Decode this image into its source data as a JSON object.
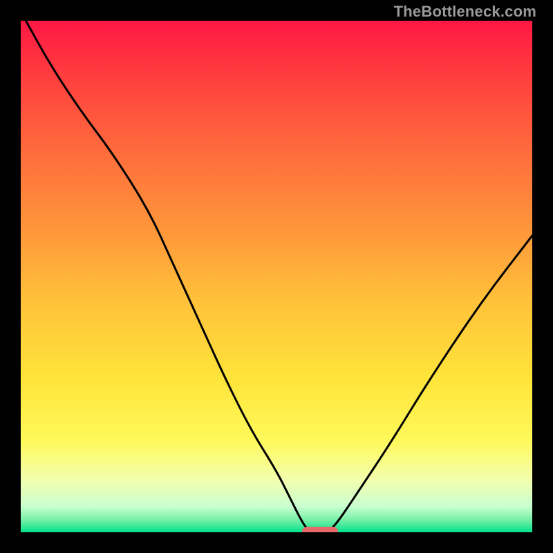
{
  "watermark": "TheBottleneck.com",
  "chart_data": {
    "type": "line",
    "title": "",
    "xlabel": "",
    "ylabel": "",
    "xlim": [
      0,
      100
    ],
    "ylim": [
      0,
      100
    ],
    "background_gradient_stops": [
      {
        "offset": 0.0,
        "color": "#ff1744"
      },
      {
        "offset": 0.1,
        "color": "#ff3b3f"
      },
      {
        "offset": 0.25,
        "color": "#ff6a3c"
      },
      {
        "offset": 0.4,
        "color": "#ff943a"
      },
      {
        "offset": 0.55,
        "color": "#ffc23a"
      },
      {
        "offset": 0.7,
        "color": "#ffe43a"
      },
      {
        "offset": 0.82,
        "color": "#fff95a"
      },
      {
        "offset": 0.9,
        "color": "#f2ffb0"
      },
      {
        "offset": 0.95,
        "color": "#c8ffd0"
      },
      {
        "offset": 0.975,
        "color": "#7af0a8"
      },
      {
        "offset": 1.0,
        "color": "#00e28a"
      }
    ],
    "series": [
      {
        "name": "bottleneck-curve",
        "x": [
          1,
          6,
          12,
          18,
          25,
          30,
          35,
          40,
          45,
          50,
          53,
          55,
          56.5,
          60,
          62,
          66,
          72,
          80,
          90,
          100
        ],
        "y": [
          100,
          91,
          82,
          74,
          63,
          52,
          41,
          30,
          20,
          12,
          6,
          2,
          0,
          0,
          2,
          8,
          17,
          30,
          45,
          58
        ]
      }
    ],
    "marker": {
      "x_start": 55,
      "x_end": 62,
      "y": 0,
      "color": "#e66a6a"
    }
  }
}
